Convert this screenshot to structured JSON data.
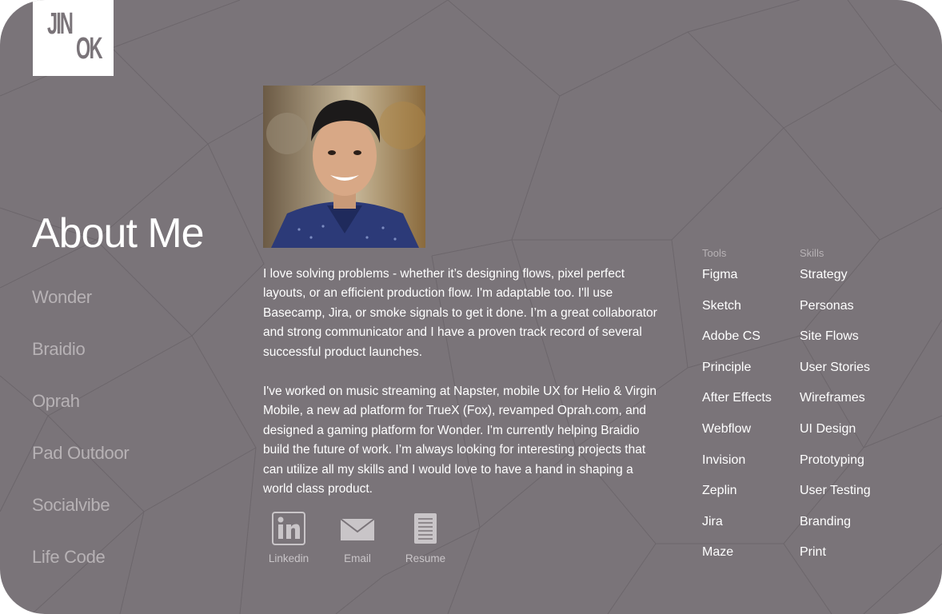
{
  "logo": {
    "line1": "JIN",
    "line2": "OK"
  },
  "page_title": "About Me",
  "nav": [
    {
      "label": "Wonder"
    },
    {
      "label": "Braidio"
    },
    {
      "label": "Oprah"
    },
    {
      "label": "Pad Outdoor"
    },
    {
      "label": "Socialvibe"
    },
    {
      "label": "Life Code"
    }
  ],
  "bio": {
    "paragraph1": "I love solving problems - whether it’s designing flows, pixel perfect layouts, or an efficient production flow. I'm adaptable too. I'll use Basecamp, Jira, or smoke signals to get it done. I’m a great collaborator and strong communicator and I have a proven track record of several successful product launches.",
    "paragraph2": "I've worked on music streaming at Napster, mobile UX for Helio & Virgin Mobile,  a new ad platform for TrueX (Fox), revamped Oprah.com, and designed a gaming platform for Wonder. I'm currently helping Braidio build the future of work. I’m always looking for interesting projects that can utilize all my skills and I would love to have a hand in shaping a world class product."
  },
  "social": {
    "linkedin": {
      "label": "Linkedin",
      "icon": "linkedin-icon"
    },
    "email": {
      "label": "Email",
      "icon": "envelope-icon"
    },
    "resume": {
      "label": "Resume",
      "icon": "document-icon"
    }
  },
  "tools": {
    "heading": "Tools",
    "items": [
      "Figma",
      "Sketch",
      "Adobe CS",
      "Principle",
      "After Effects",
      "Webflow",
      "Invision",
      "Zeplin",
      "Jira",
      "Maze"
    ]
  },
  "skills": {
    "heading": "Skills",
    "items": [
      "Strategy",
      "Personas",
      "Site Flows",
      "User Stories",
      "Wireframes",
      "UI Design",
      "Prototyping",
      "User Testing",
      "Branding",
      "Print"
    ]
  },
  "colors": {
    "background": "#7a7479",
    "text": "#ffffff",
    "muted": "#b7b2b5",
    "logo_bg": "#ffffff"
  }
}
